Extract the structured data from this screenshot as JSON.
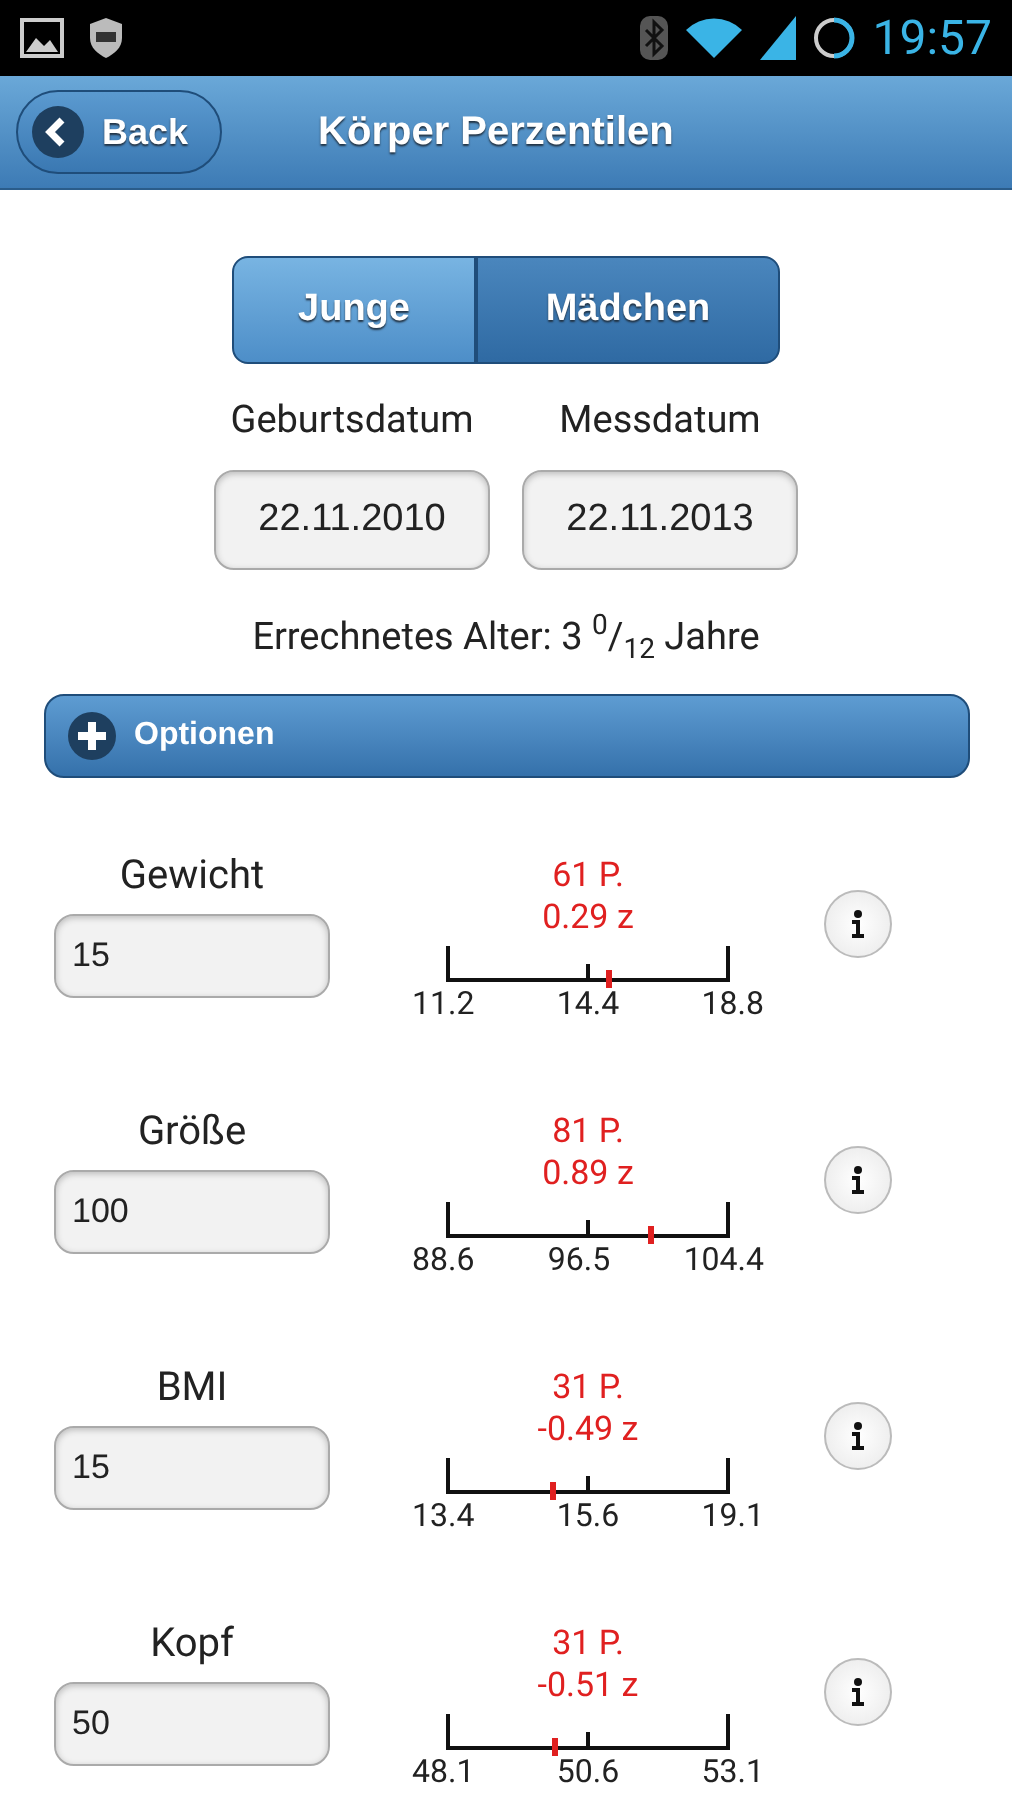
{
  "status_bar": {
    "time": "19:57"
  },
  "header": {
    "back": "Back",
    "title": "Körper Perzentilen"
  },
  "gender_toggle": [
    {
      "label": "Junge",
      "selected": true
    },
    {
      "label": "Mädchen",
      "selected": false
    }
  ],
  "dates": [
    {
      "label": "Geburtsdatum",
      "value": "22.11.2010"
    },
    {
      "label": "Messdatum",
      "value": "22.11.2013"
    }
  ],
  "age": "Errechnetes Alter: 3 $^{0}$/$_{12}$ Jahre",
  "options": {
    "label": "Optionen",
    "expanded": false
  },
  "measurements": [
    {
      "label": "Gewicht",
      "value": "15",
      "percentile": "61 P.",
      "z": "0.29 z",
      "min": "11.2",
      "mid": "14.4",
      "max": "18.8",
      "level": 0.57
    },
    {
      "label": "Größe",
      "value": "100",
      "percentile": "81 P.",
      "z": "0.89 z",
      "min": "88.6",
      "mid": "96.5",
      "max": "104.4",
      "level": 0.72
    },
    {
      "label": "BMI",
      "value": "15",
      "percentile": "31 P.",
      "z": "-0.49 z",
      "min": "13.4",
      "mid": "15.6",
      "max": "19.1",
      "level": 0.37
    },
    {
      "label": "Kopf",
      "value": "50",
      "percentile": "31 P.",
      "z": "-0.51 z",
      "min": "48.1",
      "mid": "50.6",
      "max": "53.1",
      "level": 0.38
    }
  ]
}
